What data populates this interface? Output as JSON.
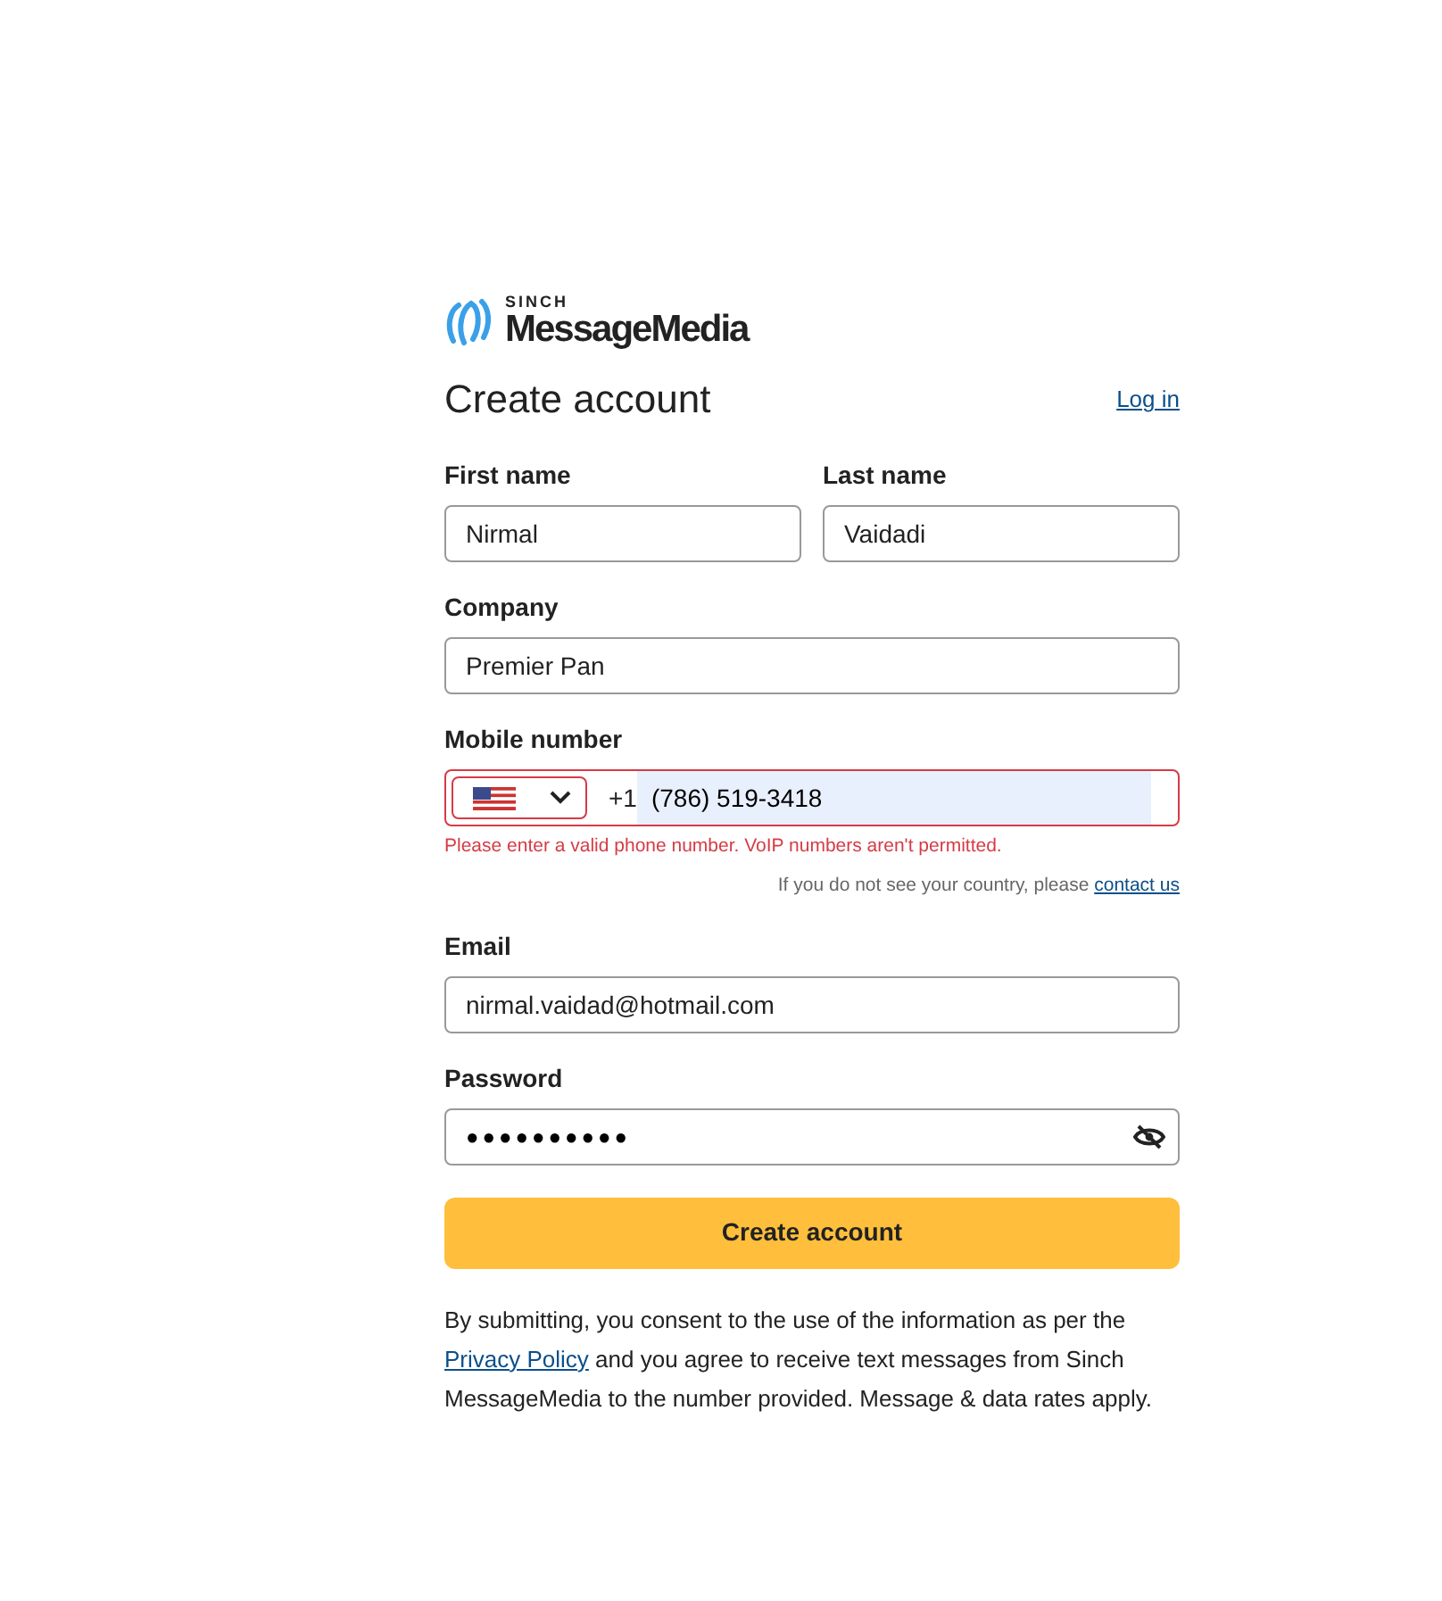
{
  "logo": {
    "top": "SINCH",
    "name": "MessageMedia"
  },
  "heading": "Create account",
  "login_link": "Log in",
  "fields": [
    {
      "kind": "text",
      "label": "First name",
      "value": "Nirmal",
      "half": true
    },
    {
      "kind": "text",
      "label": "Last name",
      "value": "Vaidadi",
      "half": true
    },
    {
      "kind": "text",
      "label": "Company",
      "value": "Premier Pan",
      "half": false
    },
    {
      "kind": "phone",
      "label": "Mobile number",
      "prefix": "+1",
      "value": "(786) 519-3418",
      "invalid": true,
      "autofilled": true,
      "error": "Please enter a valid phone number. VoIP numbers aren't permitted.",
      "hint": "If you do not see your country, please",
      "hint_link": "contact us",
      "half": false
    },
    {
      "kind": "text",
      "label": "Email",
      "value": "nirmal.vaidad@hotmail.com",
      "half": false
    },
    {
      "kind": "password",
      "label": "Password",
      "value": "●●●●●●●●●●",
      "half": false
    }
  ],
  "submit": "Create account",
  "consent": {
    "before": "By submitting, you consent to the use of the information as per the",
    "link": "Privacy Policy",
    "after": "and you agree to receive text messages from Sinch MessageMedia to the number provided. Message & data rates apply."
  }
}
